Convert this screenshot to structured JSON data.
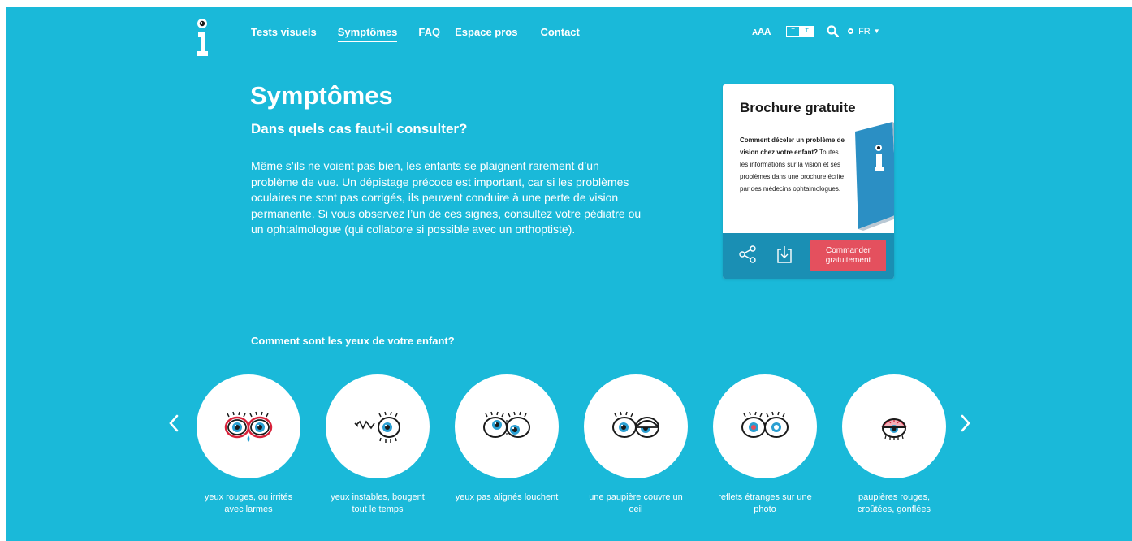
{
  "nav": {
    "logo_icon": "info-eye-logo-icon",
    "items": [
      {
        "label": "Tests visuels"
      },
      {
        "label": "Symptômes"
      },
      {
        "label": "FAQ"
      },
      {
        "label": "Espace pros"
      },
      {
        "label": "Contact"
      }
    ],
    "active_index": 1
  },
  "tools": {
    "font_size_label_small": "A",
    "font_size_label_mid": "A",
    "font_size_label_large": "A",
    "contrast_left": "T",
    "contrast_right": "T",
    "search_icon": "search-icon",
    "language": "FR"
  },
  "hero": {
    "title": "Symptômes",
    "subtitle": "Dans quels cas faut-il consulter?",
    "intro": "Même s’ils ne voient pas bien, les enfants se plaignent rarement d’un problème de vue. Un dépistage précoce est important, car si les problèmes oculaires ne sont pas corrigés, ils peuvent conduire à une perte de vision permanente.  Si vous observez l’un de ces signes, consultez votre pédiatre ou un ophtalmologue (qui collabore si possible avec un orthoptiste)."
  },
  "brochure": {
    "title": "Brochure gratuite",
    "text_bold": "Comment déceler un problème de vision chez votre enfant?",
    "text": "Toutes les informations sur la vision et ses problèmes dans une brochure écrite par des médecins ophtalmologues.",
    "order_button": "Commander gratuitement",
    "share_icon": "share-icon",
    "download_icon": "download-icon"
  },
  "symptoms": {
    "section_title": "Comment sont les yeux de votre enfant?",
    "items": [
      {
        "label": "yeux rouges, ou irrités avec larmes",
        "icon": "red-teary-eyes-icon"
      },
      {
        "label": "yeux instables, bougent tout le temps",
        "icon": "unstable-eyes-icon"
      },
      {
        "label": "yeux pas alignés louchent",
        "icon": "misaligned-eyes-icon"
      },
      {
        "label": "une paupière couvre un oeil",
        "icon": "droopy-eyelid-icon"
      },
      {
        "label": "reflets étranges sur une photo",
        "icon": "strange-reflection-icon"
      },
      {
        "label": "paupières rouges, croûtées, gonflées",
        "icon": "red-eyelid-icon"
      }
    ],
    "prev_icon": "chevron-left-icon",
    "next_icon": "chevron-right-icon"
  },
  "colors": {
    "background": "#1ab9d9",
    "accent_red": "#e4505e",
    "card_bar": "#1a8fb4"
  }
}
